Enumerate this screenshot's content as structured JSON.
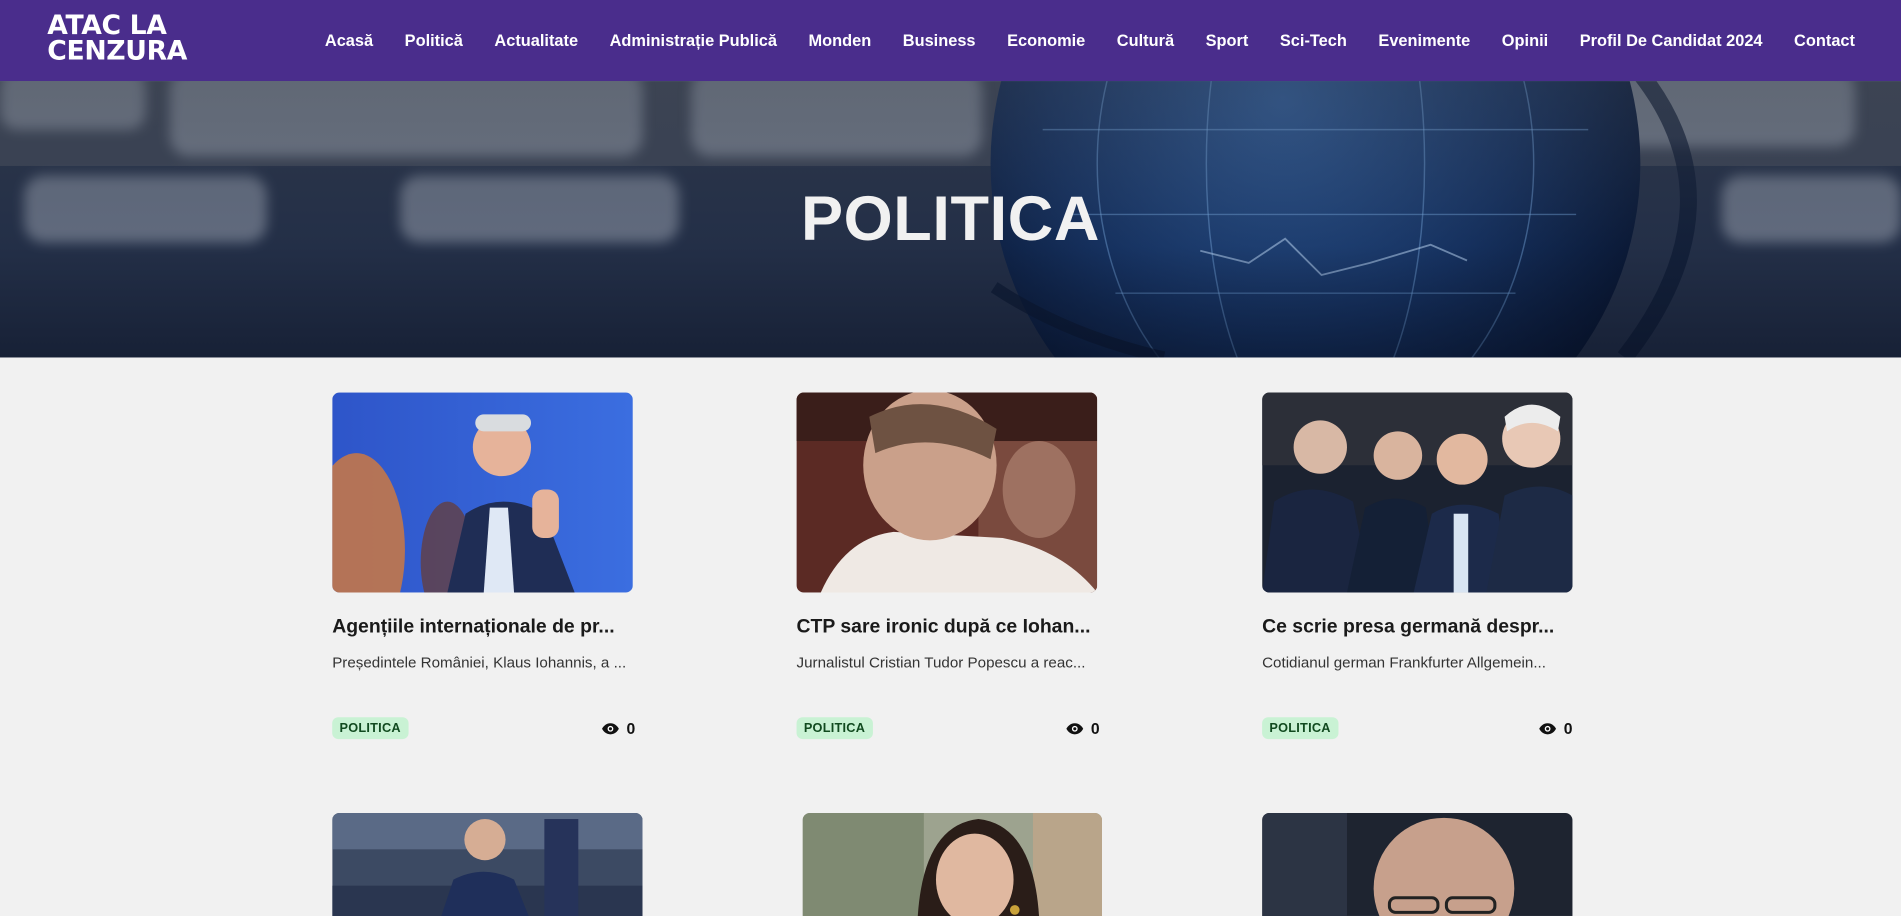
{
  "site": {
    "logo_line1": "ATAC LA",
    "logo_line2": "CENZURA",
    "brand_color": "#4a2d8c"
  },
  "nav": {
    "items": [
      "Acasă",
      "Politică",
      "Actualitate",
      "Administrație Publică",
      "Monden",
      "Business",
      "Economie",
      "Cultură",
      "Sport",
      "Sci-Tech",
      "Evenimente",
      "Opinii",
      "Profil De Candidat 2024",
      "Contact"
    ]
  },
  "hero": {
    "title": "POLITICA"
  },
  "articles": [
    {
      "title": "Agențiile internaționale de pr...",
      "excerpt": "Președintele României, Klaus Iohannis, a ...",
      "category": "POLITICA",
      "views": "0"
    },
    {
      "title": "CTP sare ironic după ce Iohan...",
      "excerpt": "Jurnalistul Cristian Tudor Popescu a reac...",
      "category": "POLITICA",
      "views": "0"
    },
    {
      "title": "Ce scrie presa germană despr...",
      "excerpt": "Cotidianul german Frankfurter Allgemein...",
      "category": "POLITICA",
      "views": "0"
    }
  ],
  "colors": {
    "badge_bg": "#c9f2d4",
    "badge_text": "#114a1f",
    "page_bg": "#f1f1f1"
  }
}
